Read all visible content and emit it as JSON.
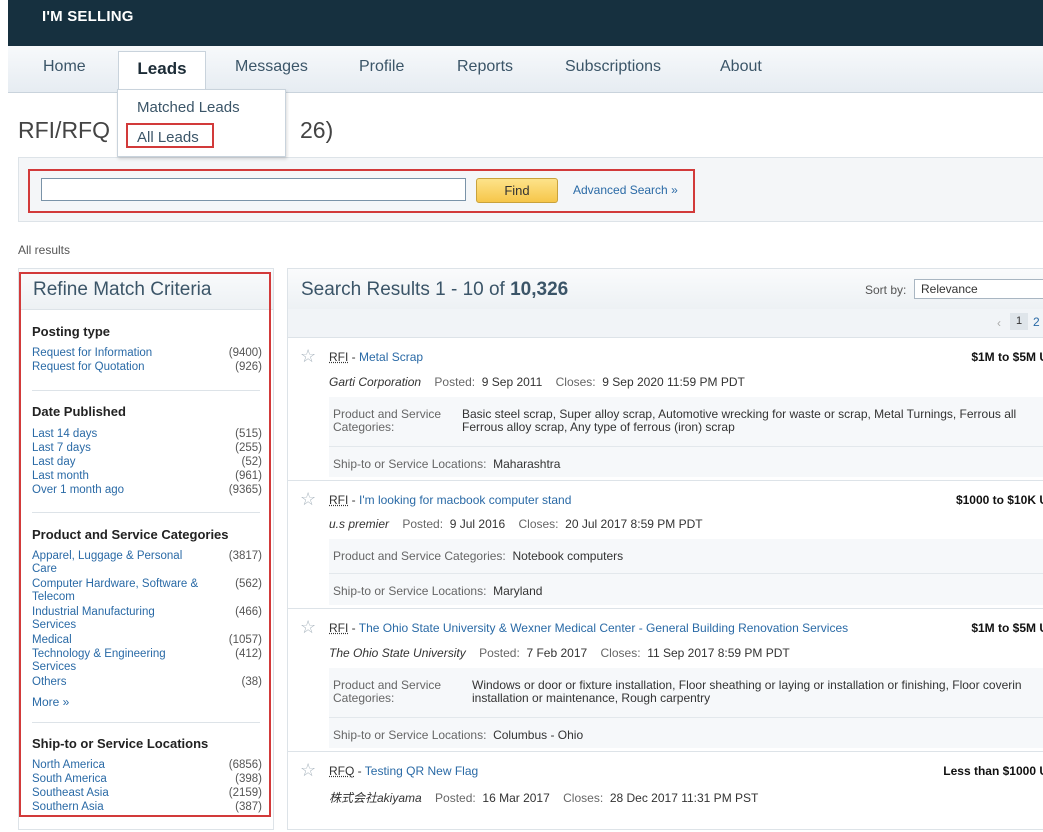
{
  "header": {
    "brand": "I'M SELLING"
  },
  "nav": {
    "tabs": [
      "Home",
      "Leads",
      "Messages",
      "Profile",
      "Reports",
      "Subscriptions",
      "About"
    ],
    "active": "Leads"
  },
  "dropdown": {
    "items": [
      "Matched Leads",
      "All Leads"
    ],
    "highlighted": "All Leads"
  },
  "page": {
    "title_prefix": "RFI/RFQ",
    "title_suffix": "26)"
  },
  "search": {
    "value": "",
    "find_label": "Find",
    "advanced_label": "Advanced Search »"
  },
  "breadcrumb": "All results",
  "refine": {
    "title": "Refine Match Criteria",
    "sections": [
      {
        "title": "Posting type",
        "rows": [
          {
            "label": "Request for Information",
            "count": "(9400)"
          },
          {
            "label": "Request for Quotation",
            "count": "(926)"
          }
        ]
      },
      {
        "title": "Date Published",
        "rows": [
          {
            "label": "Last 14 days",
            "count": "(515)"
          },
          {
            "label": "Last 7 days",
            "count": "(255)"
          },
          {
            "label": "Last day",
            "count": "(52)"
          },
          {
            "label": "Last month",
            "count": "(961)"
          },
          {
            "label": "Over 1 month ago",
            "count": "(9365)"
          }
        ]
      },
      {
        "title": "Product and Service Categories",
        "rows": [
          {
            "label": "Apparel, Luggage & Personal Care",
            "count": "(3817)"
          },
          {
            "label": "Computer Hardware, Software & Telecom",
            "count": "(562)"
          },
          {
            "label": "Industrial Manufacturing Services",
            "count": "(466)"
          },
          {
            "label": "Medical",
            "count": "(1057)"
          },
          {
            "label": "Technology & Engineering Services",
            "count": "(412)"
          },
          {
            "label": "Others",
            "count": "(38)"
          }
        ],
        "more": "More »"
      },
      {
        "title": "Ship-to or Service Locations",
        "rows": [
          {
            "label": "North America",
            "count": "(6856)"
          },
          {
            "label": "South America",
            "count": "(398)"
          },
          {
            "label": "Southeast Asia",
            "count": "(2159)"
          },
          {
            "label": "Southern Asia",
            "count": "(387)"
          }
        ]
      }
    ]
  },
  "results": {
    "title_prefix": "Search Results 1 - 10 of ",
    "total": "10,326",
    "sort_label": "Sort by:",
    "sort_value": "Relevance",
    "pager": {
      "prev": "‹",
      "current": "1",
      "next": "2"
    },
    "items": [
      {
        "type": "RFI",
        "title": "Metal Scrap",
        "price": "$1M to $5M U",
        "company": "Garti Corporation",
        "posted_label": "Posted:",
        "posted": "9 Sep 2011",
        "closes_label": "Closes:",
        "closes": "9 Sep 2020 11:59 PM PDT",
        "categories_label": "Product and Service Categories:",
        "categories": [
          "Basic steel scrap, Super alloy scrap, Automotive wrecking for waste or scrap, Metal Turnings, Ferrous all",
          "Ferrous alloy scrap, Any type of ferrous (iron) scrap"
        ],
        "locations_label": "Ship-to or Service Locations:",
        "locations": "Maharashtra"
      },
      {
        "type": "RFI",
        "title": "I'm looking for macbook computer stand",
        "price": "$1000 to $10K U",
        "company": "u.s premier",
        "posted_label": "Posted:",
        "posted": "9 Jul 2016",
        "closes_label": "Closes:",
        "closes": "20 Jul 2017 8:59 PM PDT",
        "categories_label": "Product and Service Categories:",
        "categories": [
          "Notebook computers"
        ],
        "locations_label": "Ship-to or Service Locations:",
        "locations": "Maryland"
      },
      {
        "type": "RFI",
        "title": "The Ohio State University & Wexner Medical Center - General Building Renovation Services",
        "price": "$1M to $5M U",
        "company": "The Ohio State University",
        "posted_label": "Posted:",
        "posted": "7 Feb 2017",
        "closes_label": "Closes:",
        "closes": "11 Sep 2017 8:59 PM PDT",
        "categories_label": "Product and Service Categories:",
        "categories": [
          "Windows or door or fixture installation, Floor sheathing or laying or installation or finishing, Floor coverin",
          "installation or maintenance, Rough carpentry"
        ],
        "locations_label": "Ship-to or Service Locations:",
        "locations": "Columbus - Ohio"
      },
      {
        "type": "RFQ",
        "title": "Testing QR New Flag",
        "price": "Less than $1000 U",
        "company": "株式会社akiyama",
        "posted_label": "Posted:",
        "posted": "16 Mar 2017",
        "closes_label": "Closes:",
        "closes": "28 Dec 2017 11:31 PM PST"
      }
    ]
  }
}
